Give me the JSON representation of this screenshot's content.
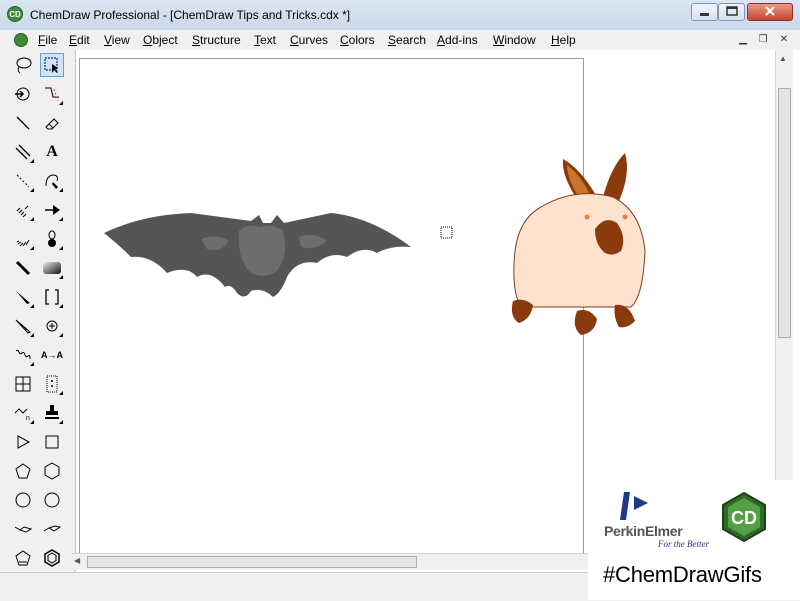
{
  "window": {
    "title": "ChemDraw Professional - [ChemDraw Tips and Tricks.cdx *]",
    "app_icon_text": "CD"
  },
  "menu": {
    "items": [
      {
        "label": "File",
        "key": "F",
        "rest": "ile"
      },
      {
        "label": "Edit",
        "key": "E",
        "rest": "dit"
      },
      {
        "label": "View",
        "key": "V",
        "rest": "iew"
      },
      {
        "label": "Object",
        "key": "O",
        "rest": "bject"
      },
      {
        "label": "Structure",
        "key": "S",
        "rest": "tructure"
      },
      {
        "label": "Text",
        "key": "T",
        "rest": "ext"
      },
      {
        "label": "Curves",
        "key": "C",
        "rest": "urves"
      },
      {
        "label": "Colors",
        "key": "C",
        "rest": "olors"
      },
      {
        "label": "Search",
        "key": "S",
        "rest": "earch"
      },
      {
        "label": "Add-ins",
        "key": "A",
        "rest": "dd-ins"
      },
      {
        "label": "Window",
        "key": "W",
        "rest": "indow"
      },
      {
        "label": "Help",
        "key": "H",
        "rest": "elp"
      }
    ]
  },
  "toolbox": {
    "tools": [
      "lasso-icon",
      "marquee-icon",
      "structure-perspective-icon",
      "mass-fragmentation-icon",
      "solid-bond-icon",
      "eraser-icon",
      "multiple-bond-icon",
      "text-icon",
      "dashed-bond-icon",
      "pen-icon",
      "hashed-bond-icon",
      "arrow-icon",
      "hashed-wedge-icon",
      "orbital-icon",
      "bold-bond-icon",
      "drawing-elements-icon",
      "wedge-bond-icon",
      "brackets-icon",
      "hashed-wedged-bond-icon",
      "chemical-symbols-icon",
      "wavy-bond-icon",
      "query-icon",
      "table-icon",
      "tlc-plate-icon",
      "acyclic-chain-icon",
      "templates-icon",
      "cyclopropane-icon",
      "cyclobutane-icon",
      "cyclopentane-icon",
      "cyclohexane-icon",
      "cycloheptane-icon",
      "cyclooctane-icon",
      "chair-cyclohexane-1-icon",
      "chair-cyclohexane-2-icon",
      "cyclopentadiene-icon",
      "benzene-icon"
    ],
    "text_tool_label": "A",
    "rename_tool_label": "A→A"
  },
  "promo": {
    "brand": "PerkinElmer",
    "slogan": "For the Better",
    "badge_text": "CD",
    "hashtag": "#ChemDrawGifs"
  },
  "colors": {
    "bat_dark": "#555555",
    "bat_light": "#6d6d6d",
    "rabbit_body": "#fde3cf",
    "rabbit_brown": "#8a3a0c",
    "accent_selected": "#cde4fb",
    "cd_green": "#3f8a3a"
  }
}
